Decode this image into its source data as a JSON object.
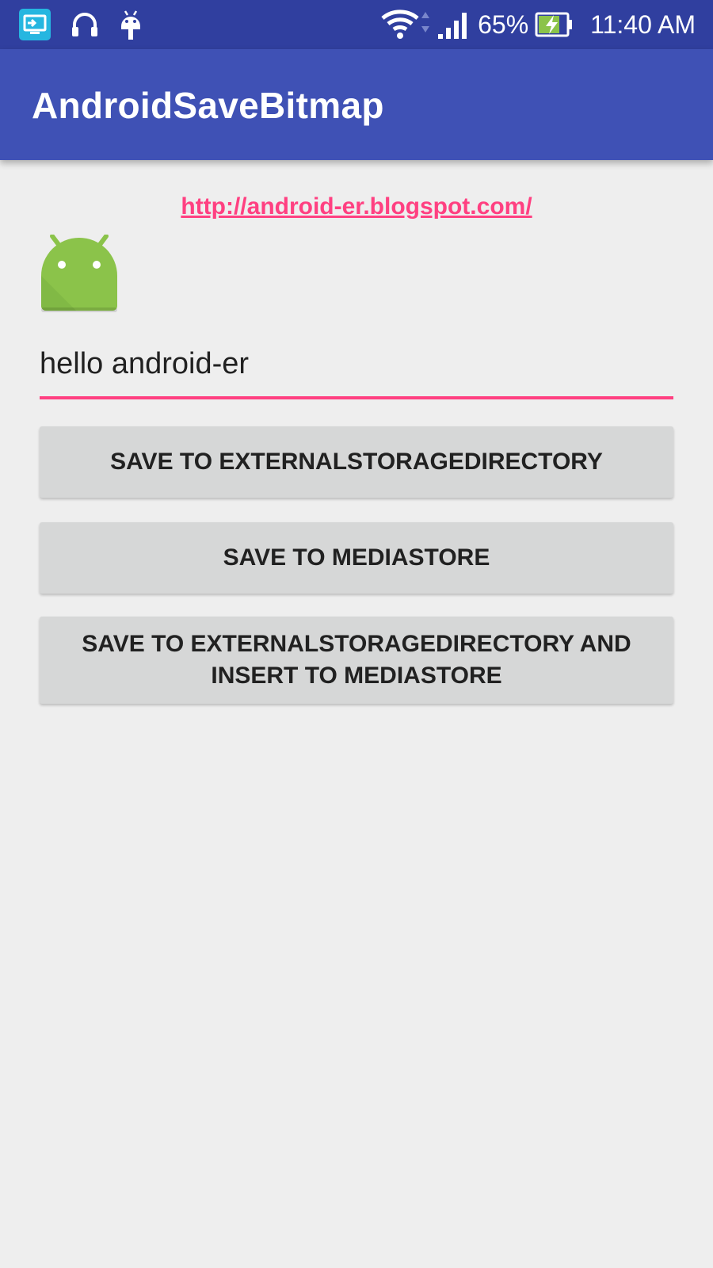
{
  "status_bar": {
    "icons_left": [
      "screen-mirror-icon",
      "headset-icon",
      "android-debug-icon"
    ],
    "icons_right": [
      "wifi-icon",
      "signal-icon",
      "battery-charging-icon"
    ],
    "battery_percent": "65%",
    "time": "11:40 AM"
  },
  "app_bar": {
    "title": "AndroidSaveBitmap"
  },
  "main": {
    "link": "http://android-er.blogspot.com/",
    "logo_icon": "android-logo-icon",
    "text_field_value": "hello android-er",
    "buttons": [
      "SAVE TO EXTERNALSTORAGEDIRECTORY",
      "SAVE TO MEDIASTORE",
      "SAVE TO EXTERNALSTORAGEDIRECTORY AND INSERT TO MEDIASTORE"
    ]
  },
  "colors": {
    "status_bar": "#303f9f",
    "app_bar": "#3f51b5",
    "accent": "#ff4081",
    "background": "#eeeeee",
    "button": "#d6d7d7",
    "android_green": "#8bc34a"
  }
}
